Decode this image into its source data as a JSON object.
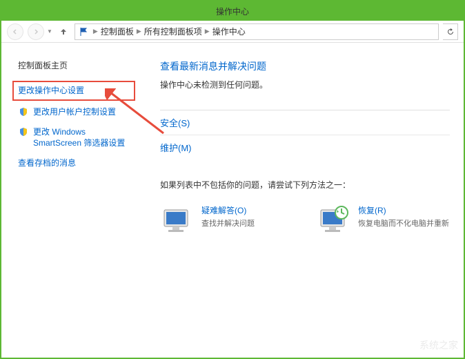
{
  "window": {
    "title": "操作中心"
  },
  "breadcrumb": {
    "items": [
      "控制面板",
      "所有控制面板项",
      "操作中心"
    ]
  },
  "sidebar": {
    "title": "控制面板主页",
    "links": [
      {
        "label": "更改操作中心设置",
        "highlighted": true
      },
      {
        "label": "更改用户帐户控制设置"
      },
      {
        "label": "更改 Windows SmartScreen 筛选器设置"
      },
      {
        "label": "查看存档的消息"
      }
    ]
  },
  "main": {
    "title": "查看最新消息并解决问题",
    "subtitle": "操作中心未检测到任何问题。",
    "sections": [
      {
        "label": "安全(S)"
      },
      {
        "label": "维护(M)"
      }
    ],
    "help_text": "如果列表中不包括你的问题，请尝试下列方法之一："
  },
  "tiles": [
    {
      "title": "疑难解答(O)",
      "desc": "查找并解决问题"
    },
    {
      "title": "恢复(R)",
      "desc": "恢复电脑而不化电脑并重新"
    }
  ],
  "watermark": "系统之家"
}
